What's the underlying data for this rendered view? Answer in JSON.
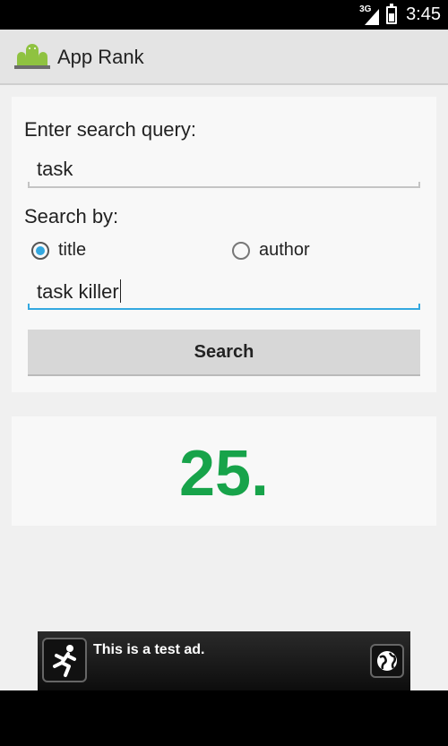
{
  "status_bar": {
    "network": "3G",
    "time": "3:45"
  },
  "action_bar": {
    "title": "App Rank",
    "logo_icon": "android-group-icon"
  },
  "form": {
    "query_label": "Enter search query:",
    "query_value": "task",
    "search_by_label": "Search by:",
    "options": [
      {
        "label": "title",
        "checked": true
      },
      {
        "label": "author",
        "checked": false
      }
    ],
    "term_value": "task killer",
    "search_button": "Search"
  },
  "result": {
    "rank": "25."
  },
  "ad": {
    "text": "This is a test ad.",
    "icon": "running-man-icon",
    "action_icon": "globe-icon"
  },
  "colors": {
    "accent": "#33a8e0",
    "rank": "#17a34a"
  }
}
